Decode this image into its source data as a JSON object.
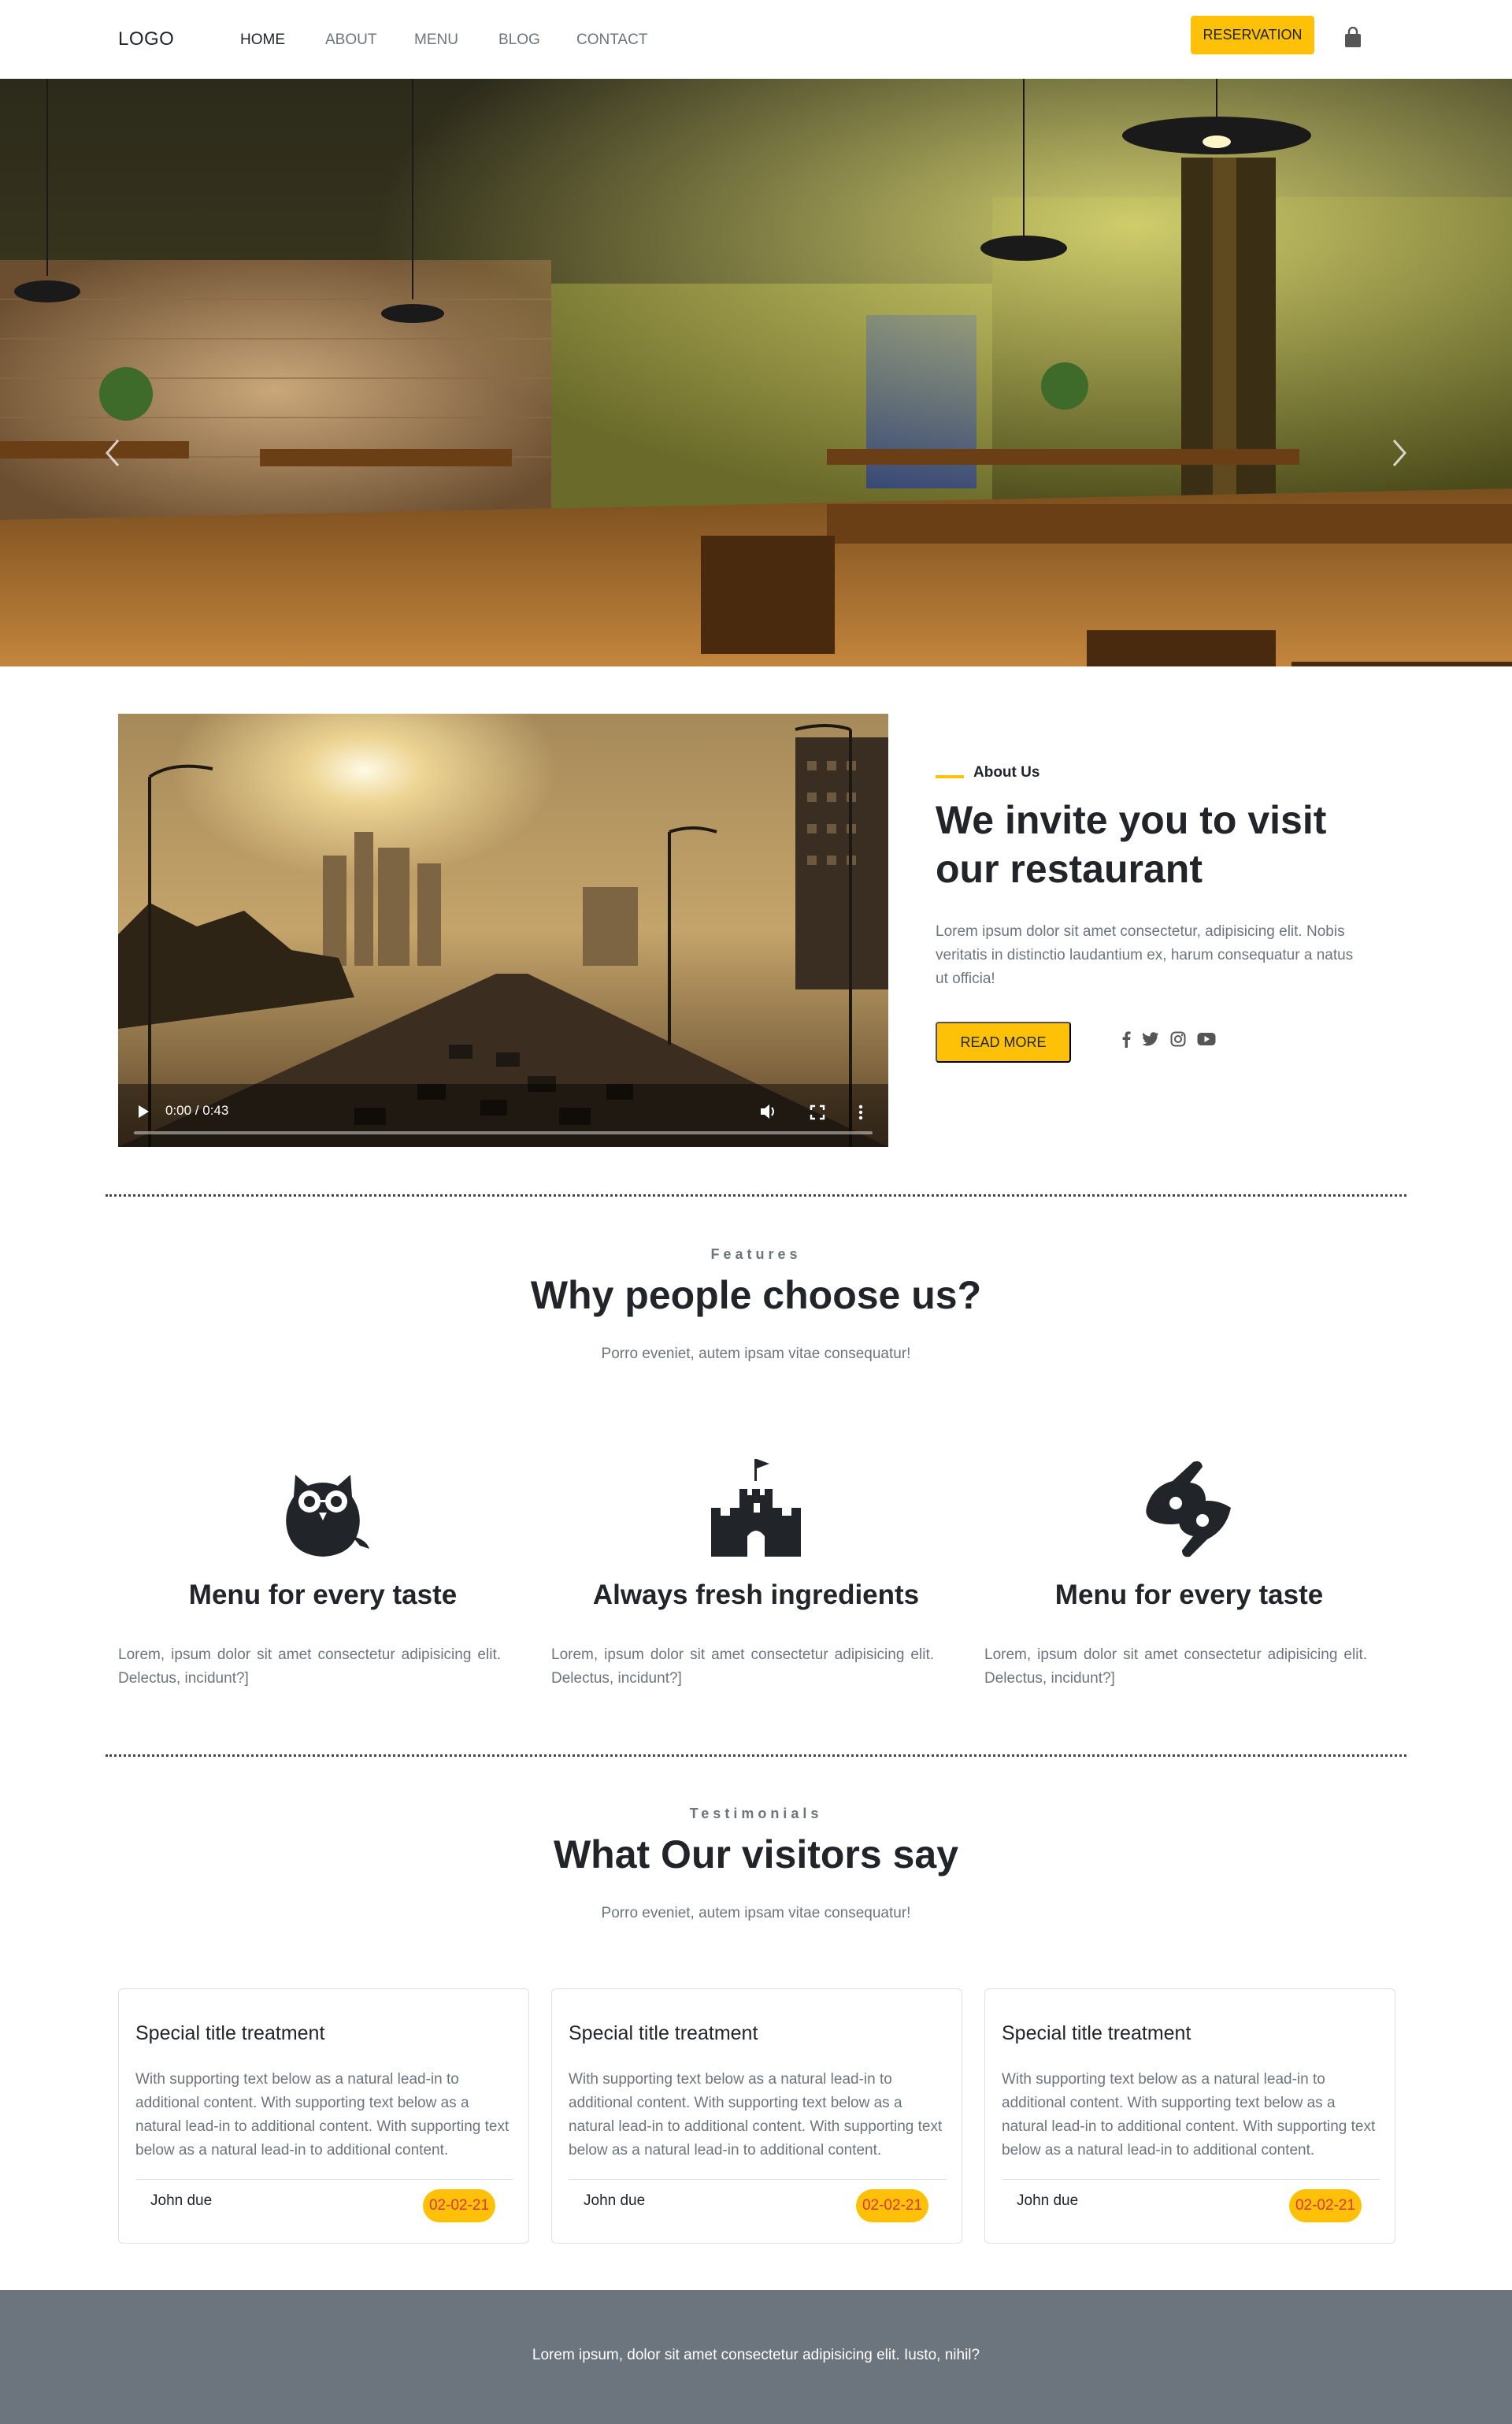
{
  "navbar": {
    "logo": "LOGO",
    "links": [
      "HOME",
      "ABOUT",
      "MENU",
      "BLOG",
      "CONTACT"
    ],
    "reservation_label": "RESERVATION",
    "cart_icon": "shopping-bag-icon"
  },
  "hero": {
    "arrows": [
      "chevron-left-icon",
      "chevron-right-icon"
    ],
    "slide_count": 3,
    "active_slide": 2
  },
  "about": {
    "video_time": "0:00 / 0:43",
    "kicker": "About Us",
    "title": "We invite you to visit our restaurant",
    "text": "Lorem ipsum dolor sit amet consectetur, adipisicing elit. Nobis veritatis in distinctio laudantium ex, harum consequatur a natus ut officia!",
    "read_more_label": "READ MORE",
    "social_icons": [
      "facebook-icon",
      "twitter-icon",
      "instagram-icon",
      "youtube-icon"
    ]
  },
  "features": {
    "kicker": "Features",
    "title": "Why people choose us?",
    "subtitle": "Porro eveniet, autem ipsam vitae consequatur!",
    "items": [
      {
        "icon": "owl-icon",
        "title": "Menu for every taste",
        "text": "Lorem, ipsum dolor sit amet consectetur adipisicing elit. Delectus, incidunt?]"
      },
      {
        "icon": "castle-icon",
        "title": "Always fresh ingredients",
        "text": "Lorem, ipsum dolor sit amet consectetur adipisicing elit. Delectus, incidunt?]"
      },
      {
        "icon": "sign-language-icon",
        "title": "Menu for every taste",
        "text": "Lorem, ipsum dolor sit amet consectetur adipisicing elit. Delectus, incidunt?]"
      }
    ]
  },
  "testimonials": {
    "kicker": "Testimonials",
    "title": "What Our visitors say",
    "subtitle": "Porro eveniet, autem ipsam vitae consequatur!",
    "cards": [
      {
        "title": "Special title treatment",
        "text": "With supporting text below as a natural lead-in to additional content. With supporting text below as a natural lead-in to additional content. With supporting text below as a natural lead-in to additional content.",
        "author": "John due",
        "date": "02-02-21"
      },
      {
        "title": "Special title treatment",
        "text": "With supporting text below as a natural lead-in to additional content. With supporting text below as a natural lead-in to additional content. With supporting text below as a natural lead-in to additional content.",
        "author": "John due",
        "date": "02-02-21"
      },
      {
        "title": "Special title treatment",
        "text": "With supporting text below as a natural lead-in to additional content. With supporting text below as a natural lead-in to additional content. With supporting text below as a natural lead-in to additional content.",
        "author": "John due",
        "date": "02-02-21"
      }
    ]
  },
  "footer": {
    "text": "Lorem ipsum, dolor sit amet consectetur adipisicing elit. Iusto, nihil?"
  },
  "colors": {
    "accent": "#ffc107",
    "date_text": "#dc3545",
    "footer_bg": "#6c757d",
    "muted_text": "#6c757d",
    "dark_text": "#212529"
  }
}
